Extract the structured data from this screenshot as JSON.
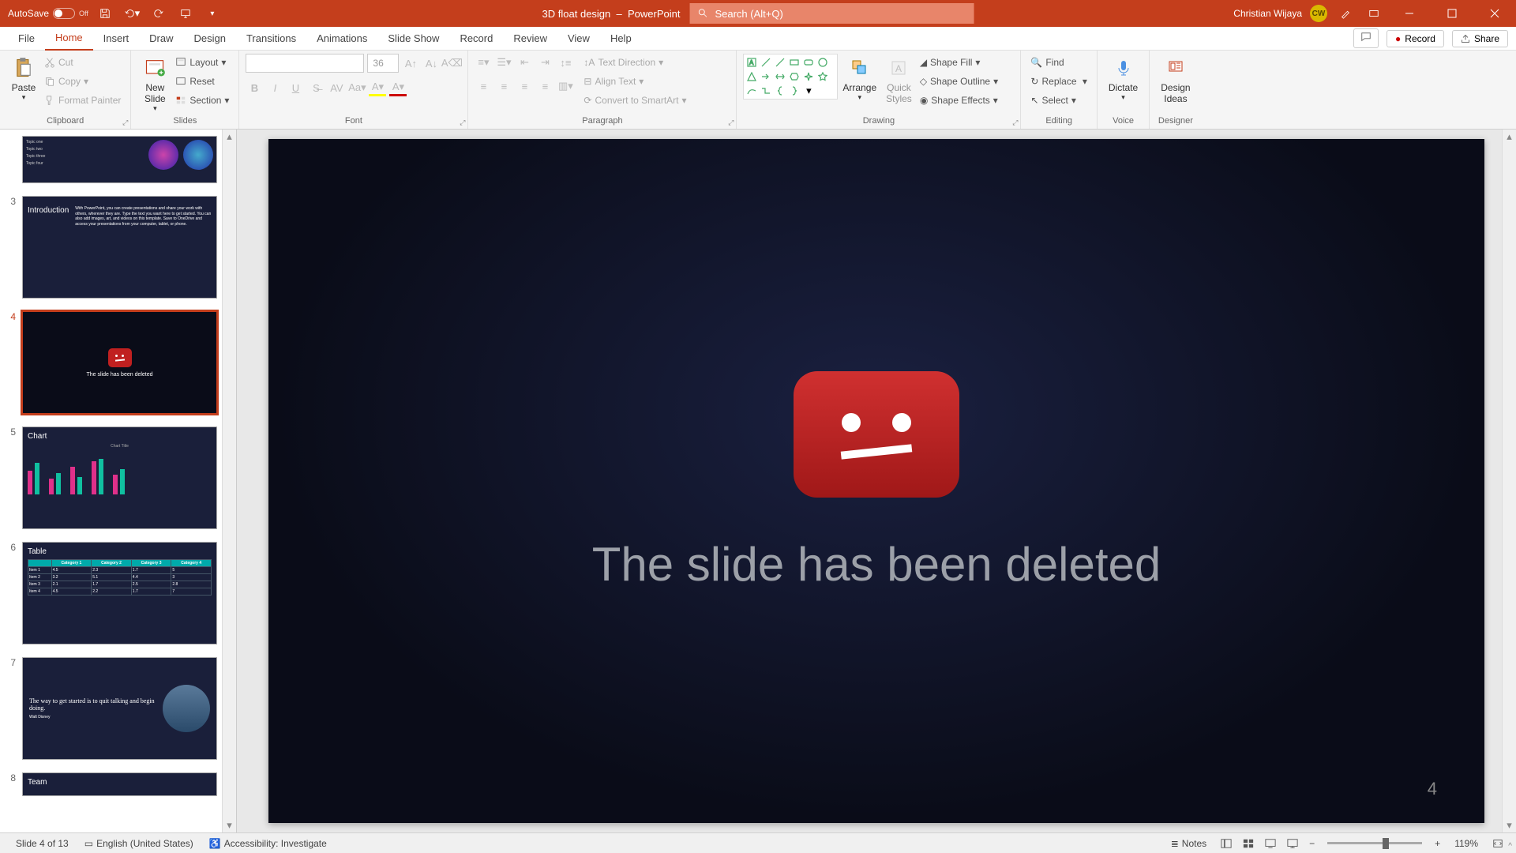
{
  "titlebar": {
    "autosave_label": "AutoSave",
    "autosave_state": "Off",
    "doc_name": "3D float design",
    "app_name": "PowerPoint",
    "search_placeholder": "Search (Alt+Q)",
    "user_name": "Christian Wijaya",
    "user_initials": "CW"
  },
  "tabs": {
    "items": [
      "File",
      "Home",
      "Insert",
      "Draw",
      "Design",
      "Transitions",
      "Animations",
      "Slide Show",
      "Record",
      "Review",
      "View",
      "Help"
    ],
    "active_index": 1,
    "record_label": "Record",
    "share_label": "Share"
  },
  "ribbon": {
    "clipboard": {
      "label": "Clipboard",
      "paste": "Paste",
      "cut": "Cut",
      "copy": "Copy",
      "format_painter": "Format Painter"
    },
    "slides": {
      "label": "Slides",
      "new_slide": "New\nSlide",
      "layout": "Layout",
      "reset": "Reset",
      "section": "Section"
    },
    "font": {
      "label": "Font",
      "size": "36"
    },
    "paragraph": {
      "label": "Paragraph",
      "text_direction": "Text Direction",
      "align_text": "Align Text",
      "smartart": "Convert to SmartArt"
    },
    "drawing": {
      "label": "Drawing",
      "arrange": "Arrange",
      "quick_styles": "Quick\nStyles",
      "shape_fill": "Shape Fill",
      "shape_outline": "Shape Outline",
      "shape_effects": "Shape Effects"
    },
    "editing": {
      "label": "Editing",
      "find": "Find",
      "replace": "Replace",
      "select": "Select"
    },
    "voice": {
      "label": "Voice",
      "dictate": "Dictate"
    },
    "designer": {
      "label": "Designer",
      "ideas": "Design\nIdeas"
    }
  },
  "thumbnails": {
    "items": [
      {
        "num": "3",
        "title": "Introduction"
      },
      {
        "num": "4",
        "title": "The slide has been deleted",
        "selected": true
      },
      {
        "num": "5",
        "title": "Chart"
      },
      {
        "num": "6",
        "title": "Table"
      },
      {
        "num": "7",
        "title": "The way to get started is to quit talking and begin doing."
      },
      {
        "num": "8",
        "title": "Team"
      }
    ]
  },
  "slide": {
    "main_text": "The slide has been deleted",
    "page_number": "4"
  },
  "status": {
    "slide_count": "Slide 4 of 13",
    "language": "English (United States)",
    "accessibility": "Accessibility: Investigate",
    "notes": "Notes",
    "zoom": "119%"
  }
}
